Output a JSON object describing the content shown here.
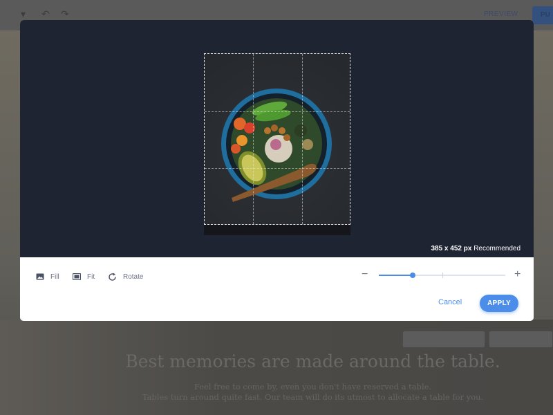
{
  "editor": {
    "preview_label": "PREVIEW",
    "publish_label": "PU"
  },
  "page": {
    "heading": "Best memories are made around the table.",
    "subtext_line1": "Feel free to come by, even you don't have reserved a table.",
    "subtext_line2": "Tables turn around quite fast. Our team will do its utmost to allocate a table for you."
  },
  "cropper": {
    "image_description_icon": "food-bowl-photo",
    "dimensions": "385 x 452 px",
    "dimensions_note": "Recommended",
    "tools": [
      {
        "label": "Fill",
        "icon": "image-icon"
      },
      {
        "label": "Fit",
        "icon": "fit-icon"
      },
      {
        "label": "Rotate",
        "icon": "rotate-icon"
      }
    ],
    "zoom": {
      "minus": "−",
      "plus": "+",
      "value": 0.27
    },
    "cancel_label": "Cancel",
    "apply_label": "APPLY"
  },
  "colors": {
    "accent": "#4b8de8",
    "crop_background": "#1f2433"
  }
}
